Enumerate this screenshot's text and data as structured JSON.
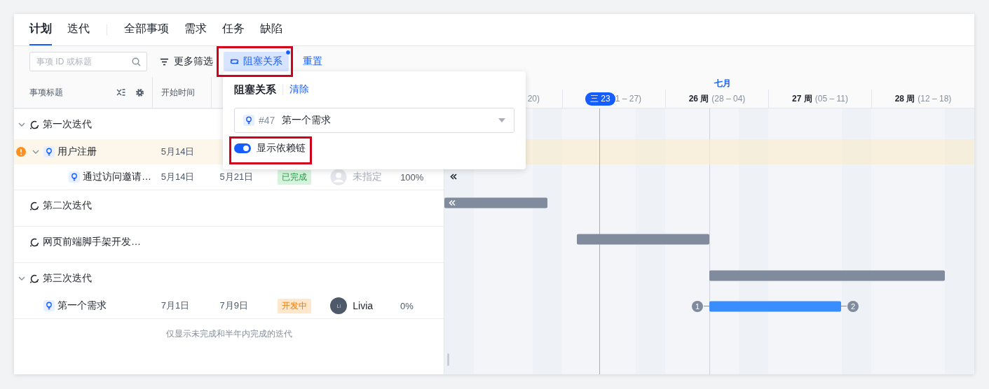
{
  "tab_groups": [
    [
      {
        "label": "计划",
        "selected": true
      },
      {
        "label": "迭代",
        "selected": false
      }
    ],
    [
      {
        "label": "全部事项",
        "selected": false
      },
      {
        "label": "需求",
        "selected": false
      },
      {
        "label": "任务",
        "selected": false
      },
      {
        "label": "缺陷",
        "selected": false
      }
    ]
  ],
  "toolbar": {
    "search": {
      "placeholder": "事项 ID 或标题"
    },
    "filter_label": "更多筛选",
    "blocking_button": {
      "label": "阻塞关系",
      "selected": true,
      "badge": true
    },
    "reset_link": "重置"
  },
  "popover": {
    "title": "阻塞关系",
    "clear_link": "清除",
    "select": {
      "id": "#47",
      "value": "第一个需求"
    },
    "toggle": {
      "label": "显示依赖链",
      "on": true
    }
  },
  "table": {
    "columns": [
      "事项标题",
      "开始时间"
    ],
    "groups": [
      {
        "title": "第一次迭代",
        "expanded": true,
        "children": [
          {
            "title": "用户注册",
            "start": "5月14日",
            "warning": true,
            "expanded": true,
            "highlighted": true,
            "children": [
              {
                "title": "通过访问邀请…",
                "start": "5月14日",
                "end": "5月21日",
                "status": {
                  "text": "已完成",
                  "kind": "done"
                },
                "assignee": {
                  "name": "未指定",
                  "assigned": false
                },
                "progress": "100%"
              }
            ]
          }
        ]
      },
      {
        "title": "第二次迭代"
      },
      {
        "title": "网页前端脚手架开发…"
      },
      {
        "title": "第三次迭代",
        "expanded": true,
        "children": [
          {
            "title": "第一个需求",
            "start": "7月1日",
            "end": "7月9日",
            "status": {
              "text": "开发中",
              "kind": "active"
            },
            "assignee": {
              "name": "Livia",
              "initials": "Li",
              "assigned": true
            },
            "progress": "0%",
            "predecessor": "1",
            "successor": "2"
          }
        ]
      }
    ],
    "footer": "仅显示未完成和半年内完成的迭代"
  },
  "timeline": {
    "month": "七月",
    "first_week_fragment": "20)",
    "today": "三 23",
    "today_week_fragment": "1 – 27)",
    "weeks": [
      {
        "label": "26 周",
        "range": "(28 – 04)"
      },
      {
        "label": "27 周",
        "range": "(05 – 11)"
      },
      {
        "label": "28 周",
        "range": "(12 – 18)"
      }
    ]
  }
}
